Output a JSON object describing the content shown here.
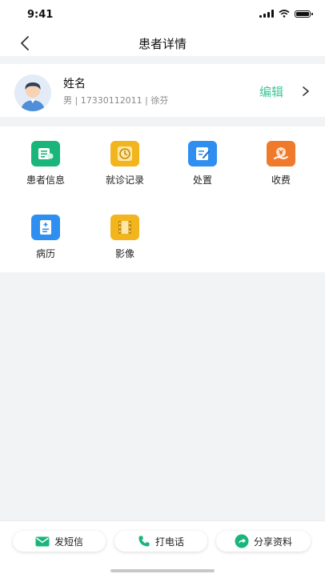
{
  "status_bar": {
    "time": "9:41"
  },
  "nav": {
    "title": "患者详情"
  },
  "profile": {
    "name": "姓名",
    "meta": "男 | 17330112011 | 徐芬",
    "edit_label": "编辑"
  },
  "grid": {
    "items": [
      {
        "label": "患者信息",
        "icon": "patient-info-icon",
        "color": "#19b57a"
      },
      {
        "label": "就诊记录",
        "icon": "clock-icon",
        "color": "#f3b51d"
      },
      {
        "label": "处置",
        "icon": "pen-note-icon",
        "color": "#2f8ff0"
      },
      {
        "label": "收费",
        "icon": "money-hand-icon",
        "color": "#f07a2c"
      },
      {
        "label": "病历",
        "icon": "medical-record-icon",
        "color": "#2f8ff0"
      },
      {
        "label": "影像",
        "icon": "film-icon",
        "color": "#f3b51d"
      }
    ]
  },
  "actions": {
    "sms_label": "发短信",
    "call_label": "打电话",
    "share_label": "分享资料"
  },
  "colors": {
    "accent": "#3cc59a",
    "background": "#f2f3f5"
  }
}
